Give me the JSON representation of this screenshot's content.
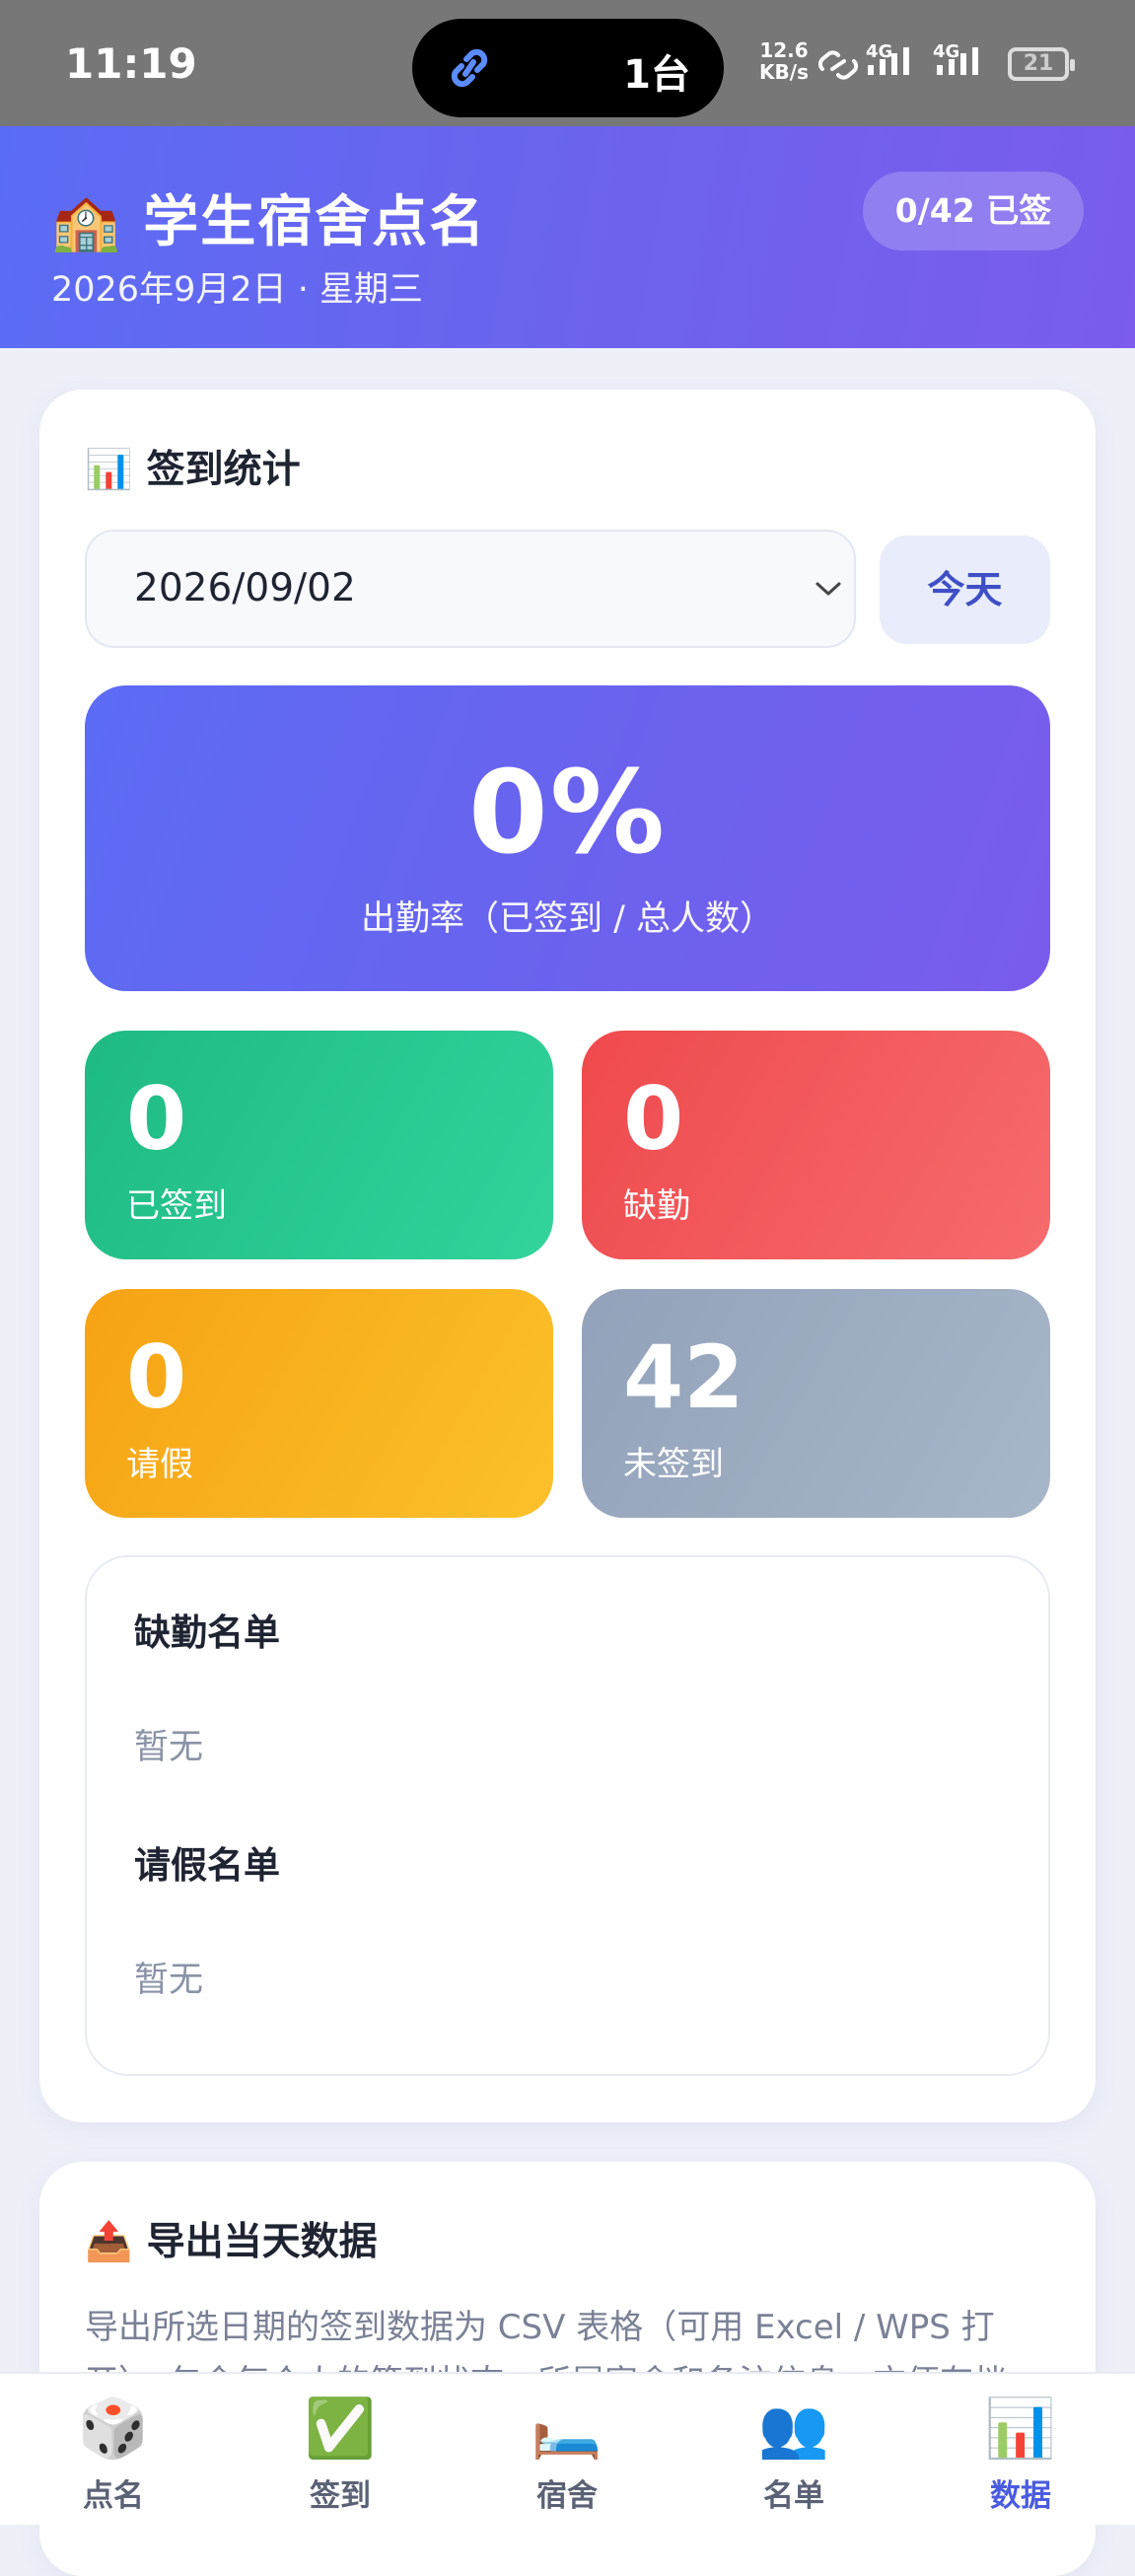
{
  "status": {
    "time": "11:19",
    "island_text": "1台",
    "speed_top": "12.6",
    "speed_bottom": "KB/s",
    "net1": "4G",
    "net2": "4G",
    "battery": "21"
  },
  "header": {
    "icon": "🏫",
    "title": "学生宿舍点名",
    "date": "2026年9月2日 · 星期三",
    "count_pill": "0/42 已签"
  },
  "stats": {
    "icon": "📊",
    "title": "签到统计",
    "date_value": "2026/09/02",
    "today_label": "今天",
    "rate_value": "0%",
    "rate_label": "出勤率（已签到 / 总人数）",
    "signed": {
      "value": "0",
      "label": "已签到"
    },
    "absent": {
      "value": "0",
      "label": "缺勤"
    },
    "leave": {
      "value": "0",
      "label": "请假"
    },
    "unsigned": {
      "value": "42",
      "label": "未签到"
    },
    "absent_list_title": "缺勤名单",
    "absent_list_empty": "暂无",
    "leave_list_title": "请假名单",
    "leave_list_empty": "暂无"
  },
  "export": {
    "icon": "📤",
    "title": "导出当天数据",
    "description": "导出所选日期的签到数据为 CSV 表格（可用 Excel / WPS 打开），包含每个人的签到状态、所属宿舍和备注信息，方便存档"
  },
  "tabs": [
    {
      "icon": "🎲",
      "label": "点名"
    },
    {
      "icon": "✅",
      "label": "签到"
    },
    {
      "icon": "🛏️",
      "label": "宿舍"
    },
    {
      "icon": "👥",
      "label": "名单"
    },
    {
      "icon": "📊",
      "label": "数据"
    }
  ],
  "colors": {
    "accent": "#5b6cf4",
    "signed": "#1fba84",
    "absent": "#ef4a4d",
    "leave": "#f6a314",
    "unsigned": "#93a2ba"
  }
}
